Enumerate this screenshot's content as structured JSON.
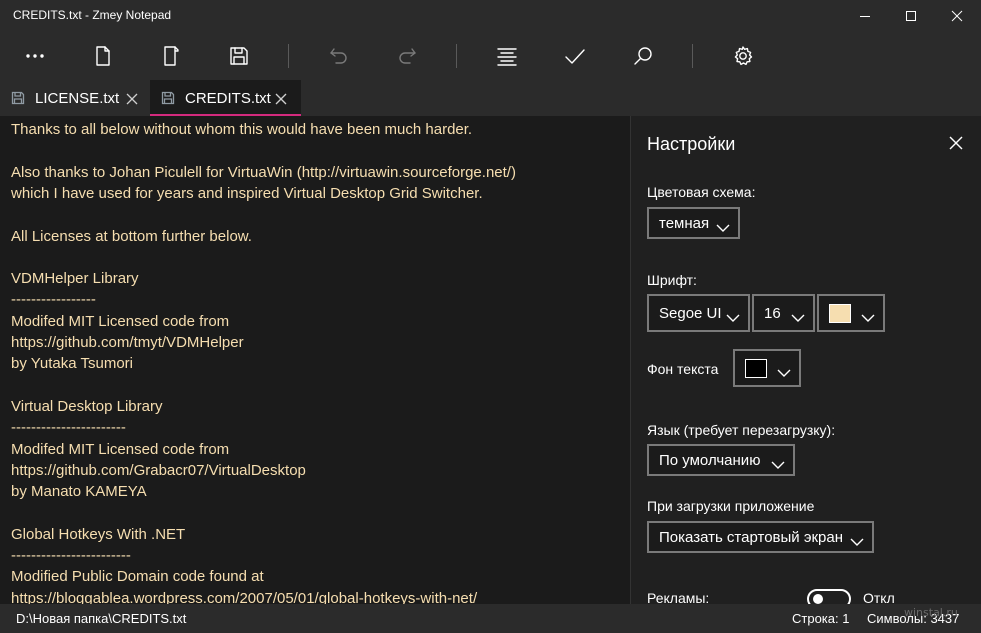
{
  "window": {
    "title": "CREDITS.txt - Zmey Notepad"
  },
  "toolbar": {
    "buttons": [
      {
        "name": "more-icon"
      },
      {
        "name": "new-file-icon"
      },
      {
        "name": "open-file-icon"
      },
      {
        "name": "save-icon"
      },
      {
        "name": "undo-icon",
        "disabled": true
      },
      {
        "name": "redo-icon",
        "disabled": true
      },
      {
        "name": "align-icon"
      },
      {
        "name": "check-icon"
      },
      {
        "name": "search-icon"
      },
      {
        "name": "gear-icon"
      }
    ]
  },
  "tabs": [
    {
      "label": "LICENSE.txt",
      "active": false
    },
    {
      "label": "CREDITS.txt",
      "active": true
    }
  ],
  "editor": {
    "text_color": "#f6deb0",
    "lines": [
      "Thanks to all below without whom this would have been much harder.",
      "",
      "Also thanks to Johan Piculell for VirtuaWin (http://virtuawin.sourceforge.net/)",
      "which I have used for years and inspired Virtual Desktop Grid Switcher.",
      "",
      "All Licenses at bottom further below.",
      "",
      "VDMHelper Library",
      "-----------------",
      "Modifed MIT Licensed code from",
      "https://github.com/tmyt/VDMHelper",
      "by Yutaka Tsumori",
      "",
      "Virtual Desktop Library",
      "-----------------------",
      "Modifed MIT Licensed code from",
      "https://github.com/Grabacr07/VirtualDesktop",
      "by Manato KAMEYA",
      "",
      "Global Hotkeys With .NET",
      "------------------------",
      "Modified Public Domain code found at",
      "https://bloggablea.wordpress.com/2007/05/01/global-hotkeys-with-net/"
    ]
  },
  "settings": {
    "title": "Настройки",
    "color_scheme": {
      "label": "Цветовая схема:",
      "value": "темная"
    },
    "font": {
      "label": "Шрифт:",
      "family": "Segoe UI",
      "size": "16",
      "color": "#f6deb0"
    },
    "text_bg": {
      "label": "Фон текста",
      "color": "#000000"
    },
    "language": {
      "label": "Язык (требует перезагрузку):",
      "value": "По умолчанию"
    },
    "startup": {
      "label": "При загрузки приложение",
      "value": "Показать стартовый экран"
    },
    "ads": {
      "label": "Рекламы:",
      "state": "Откл",
      "on": false
    }
  },
  "status": {
    "path": "D:\\Новая папка\\CREDITS.txt",
    "line": "Строка: 1",
    "chars": "Символы: 3437"
  },
  "watermark": "winstal.ru"
}
